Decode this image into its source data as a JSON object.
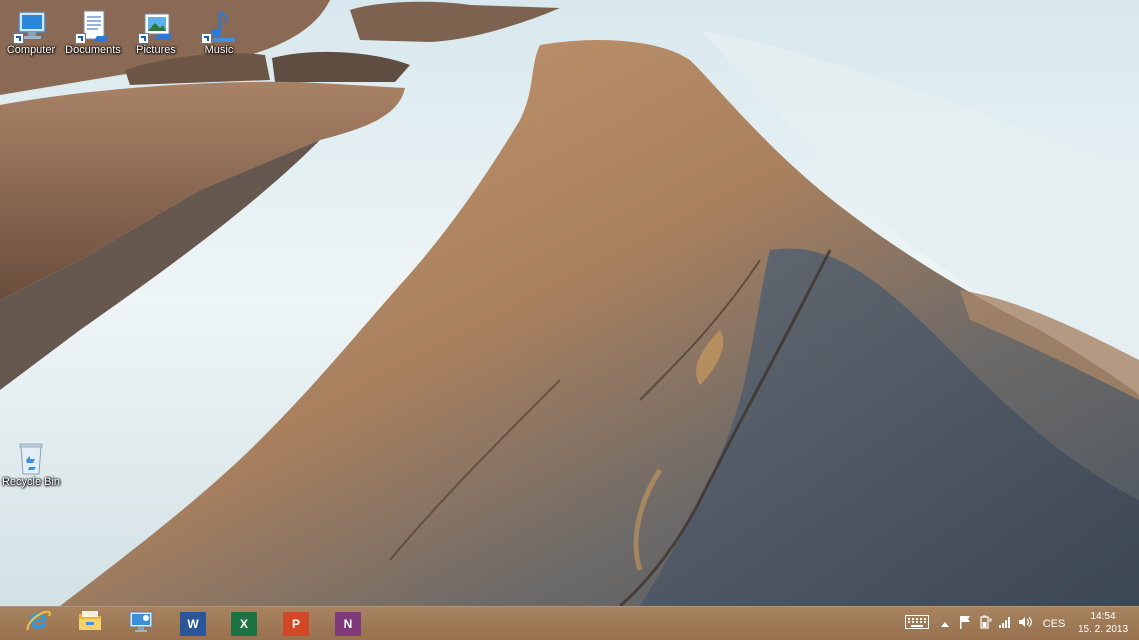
{
  "desktop": {
    "icons": [
      {
        "label": "Computer",
        "icon": "computer-icon"
      },
      {
        "label": "Documents",
        "icon": "documents-icon"
      },
      {
        "label": "Pictures",
        "icon": "pictures-icon"
      },
      {
        "label": "Music",
        "icon": "music-icon"
      },
      {
        "label": "Recycle Bin",
        "icon": "recycle-bin-icon"
      }
    ]
  },
  "taskbar": {
    "pinned": [
      {
        "name": "Internet Explorer",
        "icon": "internet-explorer-icon",
        "color": "#1e90d8"
      },
      {
        "name": "File Explorer",
        "icon": "file-explorer-icon",
        "color": "#f2c04a"
      },
      {
        "name": "Remote Desktop",
        "icon": "remote-desktop-icon",
        "color": "#3a8fd6"
      },
      {
        "name": "Word",
        "icon": "word-icon",
        "color": "#2a5699",
        "glyph": "W"
      },
      {
        "name": "Excel",
        "icon": "excel-icon",
        "color": "#1f7244",
        "glyph": "X"
      },
      {
        "name": "PowerPoint",
        "icon": "powerpoint-icon",
        "color": "#d24726",
        "glyph": "P"
      },
      {
        "name": "OneNote",
        "icon": "onenote-icon",
        "color": "#80397b",
        "glyph": "N"
      }
    ],
    "tray": {
      "language": "CES",
      "time": "14:54",
      "date": "15. 2. 2013",
      "icons": [
        "keyboard-icon",
        "show-hidden-icons-chevron",
        "action-center-flag-icon",
        "power-icon",
        "network-signal-icon",
        "volume-icon"
      ]
    }
  }
}
